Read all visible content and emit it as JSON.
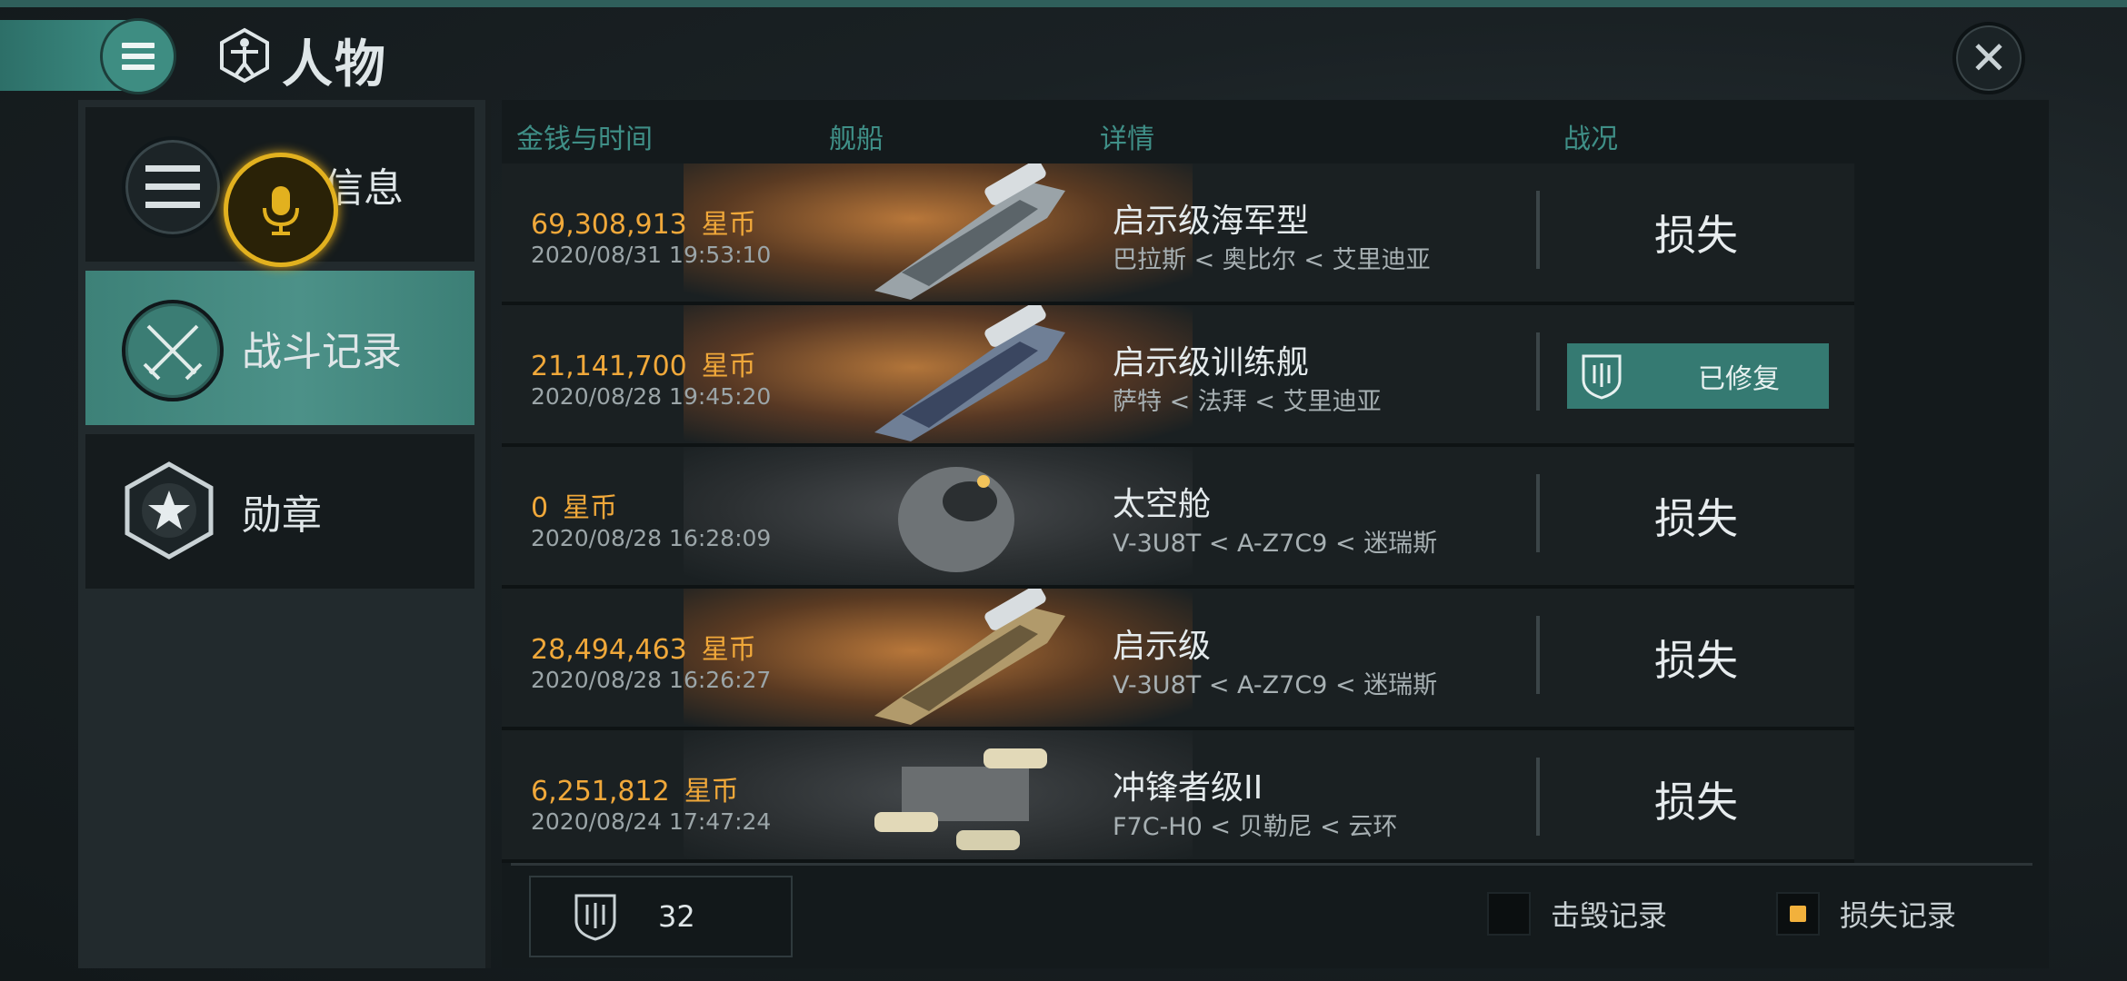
{
  "header": {
    "title": "人物",
    "close_icon": "close-icon",
    "menu_icon": "menu-icon"
  },
  "sidebar": {
    "items": [
      {
        "label": "信息",
        "icon": "menu-list-icon",
        "active": false
      },
      {
        "label": "战斗记录",
        "icon": "crossed-swords-icon",
        "active": true
      },
      {
        "label": "勋章",
        "icon": "star-badge-icon",
        "active": false
      }
    ],
    "voice_icon": "microphone-icon"
  },
  "table": {
    "columns": [
      "金钱与时间",
      "舰船",
      "详情",
      "战况"
    ],
    "rows": [
      {
        "amount": "69,308,913",
        "unit": "星币",
        "date": "2020/08/31  19:53:10",
        "ship": "启示级海军型",
        "location": "巴拉斯 < 奥比尔 < 艾里迪亚",
        "status": "损失",
        "repaired": false
      },
      {
        "amount": "21,141,700",
        "unit": "星币",
        "date": "2020/08/28  19:45:20",
        "ship": "启示级训练舰",
        "location": "萨特 < 法拜 < 艾里迪亚",
        "status": "已修复",
        "repaired": true
      },
      {
        "amount": "0",
        "unit": "星币",
        "date": "2020/08/28  16:28:09",
        "ship": "太空舱",
        "location": "V-3U8T < A-Z7C9 < 迷瑞斯",
        "status": "损失",
        "repaired": false
      },
      {
        "amount": "28,494,463",
        "unit": "星币",
        "date": "2020/08/28  16:26:27",
        "ship": "启示级",
        "location": "V-3U8T < A-Z7C9 < 迷瑞斯",
        "status": "损失",
        "repaired": false
      },
      {
        "amount": "6,251,812",
        "unit": "星币",
        "date": "2020/08/24  17:47:24",
        "ship": "冲锋者级II",
        "location": "F7C-H0 < 贝勒尼 < 云环",
        "status": "损失",
        "repaired": false
      }
    ]
  },
  "footer": {
    "count": "32",
    "kill_record": "击毁记录",
    "loss_record": "损失记录",
    "kill_checked": false,
    "loss_checked": true
  },
  "colors": {
    "accent": "#3d8178",
    "money": "#f0a83a",
    "voice_ring": "#e2b11f"
  }
}
